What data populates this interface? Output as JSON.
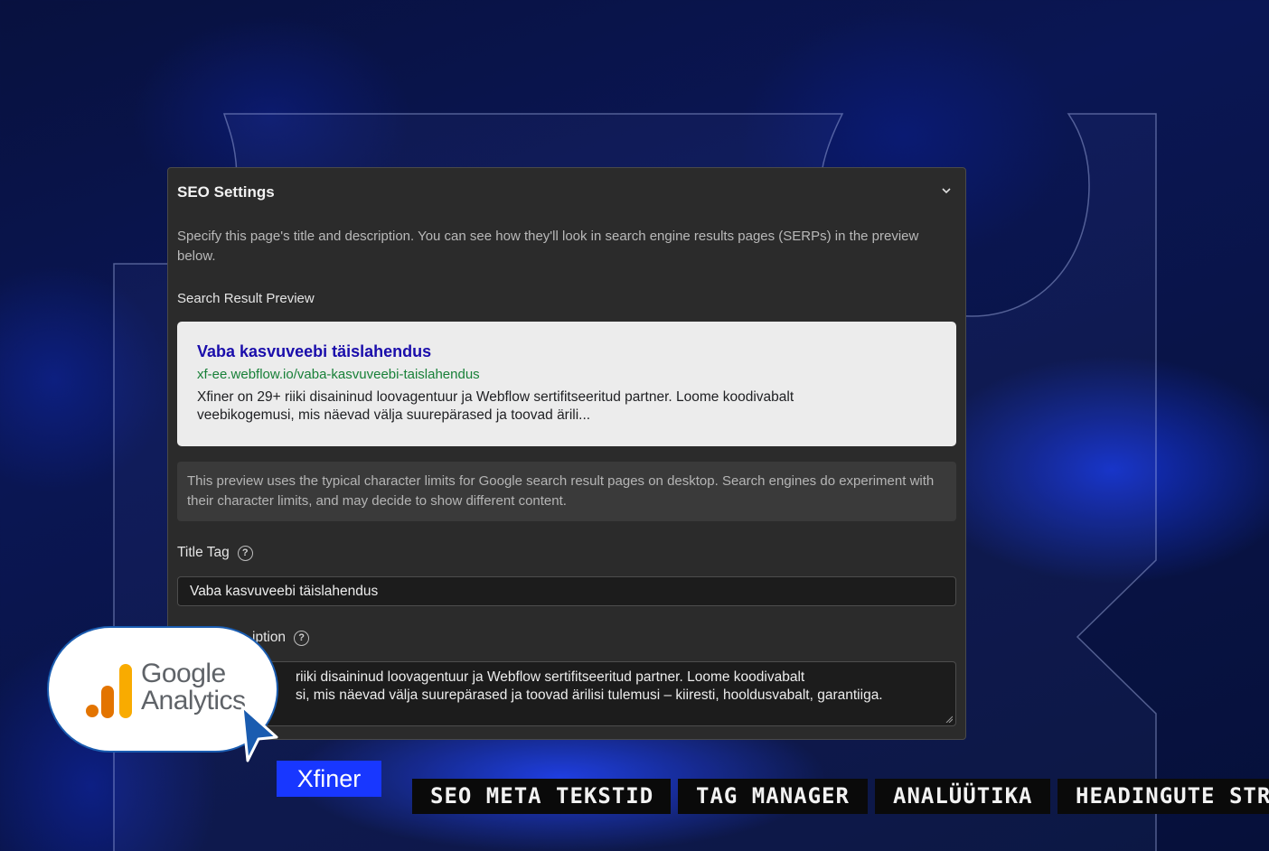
{
  "seo_panel": {
    "title": "SEO Settings",
    "description": "Specify this page's title and description. You can see how they'll look in search engine results pages (SERPs) in the preview below.",
    "preview_label": "Search Result Preview",
    "serp": {
      "title": "Vaba kasvuveebi täislahendus",
      "url": "xf-ee.webflow.io/vaba-kasvuveebi-taislahendus",
      "snippet_line1": "Xfiner on 29+ riiki disaininud loovagentuur ja Webflow sertifitseeritud partner. Loome koodivabalt",
      "snippet_line2": "veebikogemusi, mis näevad välja suurepärased ja toovad ärili..."
    },
    "note": "This preview uses the typical character limits for Google search result pages on desktop. Search engines do experiment with their character limits, and may decide to show different content.",
    "title_tag_label": "Title Tag",
    "title_tag_value": "Vaba kasvuveebi täislahendus",
    "meta_desc_label_visible": "iption",
    "meta_desc_line1": "riiki disaininud loovagentuur ja Webflow sertifitseeritud partner. Loome koodivabalt",
    "meta_desc_line2": "si, mis näevad välja suurepärased ja toovad ärilisi tulemusi – kiiresti, hooldusvabalt, garantiiga.",
    "help_glyph": "?"
  },
  "badge": {
    "line1": "Google",
    "line2": "Analytics"
  },
  "xfiner_label": "Xfiner",
  "chips": [
    "SEO META TEKSTID",
    "TAG MANAGER",
    "ANALÜÜTIKA",
    "HEADINGUTE STR"
  ],
  "colors": {
    "serp_title": "#1a0dab",
    "serp_url": "#188038",
    "xfiner_blue": "#1837ff",
    "ga_orange": "#f9ab00",
    "ga_dark_orange": "#e37400"
  }
}
